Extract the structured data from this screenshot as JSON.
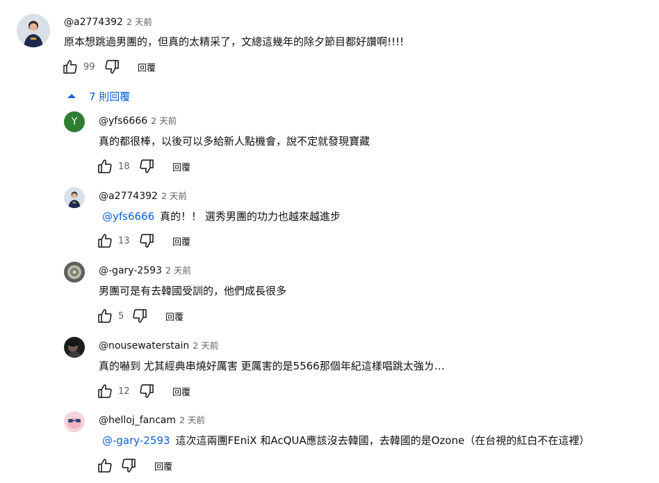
{
  "accent": "#065fd4",
  "top_comment": {
    "author": "@a2774392",
    "time": "2 天前",
    "text": "原本想跳過男團的，但真的太精采了，文總這幾年的除夕節目都好讚啊!!!!",
    "likes": "99",
    "reply_label": "回覆"
  },
  "replies_toggle": {
    "label": "7 則回覆",
    "icon": "chevron-up-icon"
  },
  "replies": [
    {
      "author": "@yfs6666",
      "time": "2 天前",
      "mention": "",
      "text": "真的都很棒，以後可以多給新人點機會，說不定就發現寶藏",
      "likes": "18",
      "reply_label": "回覆",
      "avatar_letter": "Y",
      "avatar_color": "#2e7d32"
    },
    {
      "author": "@a2774392",
      "time": "2 天前",
      "mention": "@yfs6666",
      "text": "真的！！ 選秀男團的功力也越來越進步",
      "likes": "13",
      "reply_label": "回覆"
    },
    {
      "author": "@-gary-2593",
      "time": "2 天前",
      "mention": "",
      "text": "男團可是有去韓國受訓的，他們成長很多",
      "likes": "5",
      "reply_label": "回覆"
    },
    {
      "author": "@nousewaterstain",
      "time": "2 天前",
      "mention": "",
      "text": "真的嚇到 尤其經典串燒好厲害 更厲害的是5566那個年紀這樣唱跳太強ㄌ…",
      "likes": "12",
      "reply_label": "回覆"
    },
    {
      "author": "@helloj_fancam",
      "time": "2 天前",
      "mention": "@-gary-2593",
      "text": "這次這兩團FEniX 和AcQUA應該沒去韓國，去韓國的是Ozone（在台視的紅白不在這裡）",
      "likes": "",
      "reply_label": "回覆"
    }
  ]
}
